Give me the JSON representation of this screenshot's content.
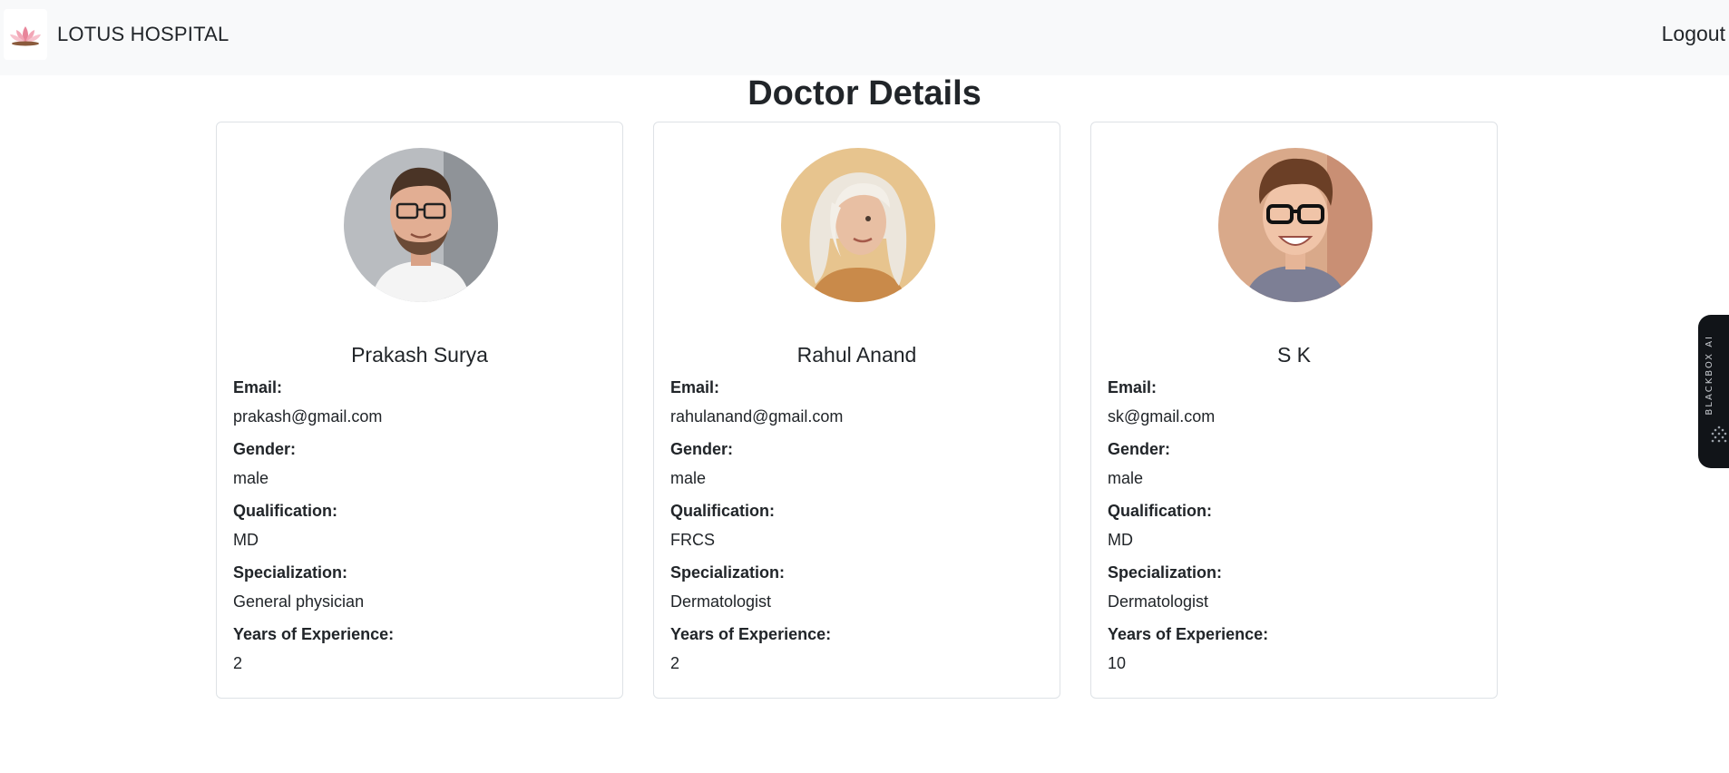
{
  "navbar": {
    "brand": "LOTUS HOSPITAL",
    "logout": "Logout",
    "logo_icon": "lotus-icon"
  },
  "page": {
    "title": "Doctor Details"
  },
  "field_labels": {
    "email": "Email:",
    "gender": "Gender:",
    "qualification": "Qualification:",
    "specialization": "Specialization:",
    "experience": "Years of Experience:"
  },
  "doctors": [
    {
      "name": "Prakash Surya",
      "email": "prakash@gmail.com",
      "gender": "male",
      "qualification": "MD",
      "specialization": "General physician",
      "experience": "2"
    },
    {
      "name": "Rahul Anand",
      "email": "rahulanand@gmail.com",
      "gender": "male",
      "qualification": "FRCS",
      "specialization": "Dermatologist",
      "experience": "2"
    },
    {
      "name": "S K",
      "email": "sk@gmail.com",
      "gender": "male",
      "qualification": "MD",
      "specialization": "Dermatologist",
      "experience": "10"
    }
  ],
  "side_widget": {
    "label": "BLACKBOX AI"
  },
  "colors": {
    "navbar_bg": "#f8f9fa",
    "text": "#212529",
    "card_border": "#dee2e6",
    "side_tab_bg": "#111418"
  }
}
